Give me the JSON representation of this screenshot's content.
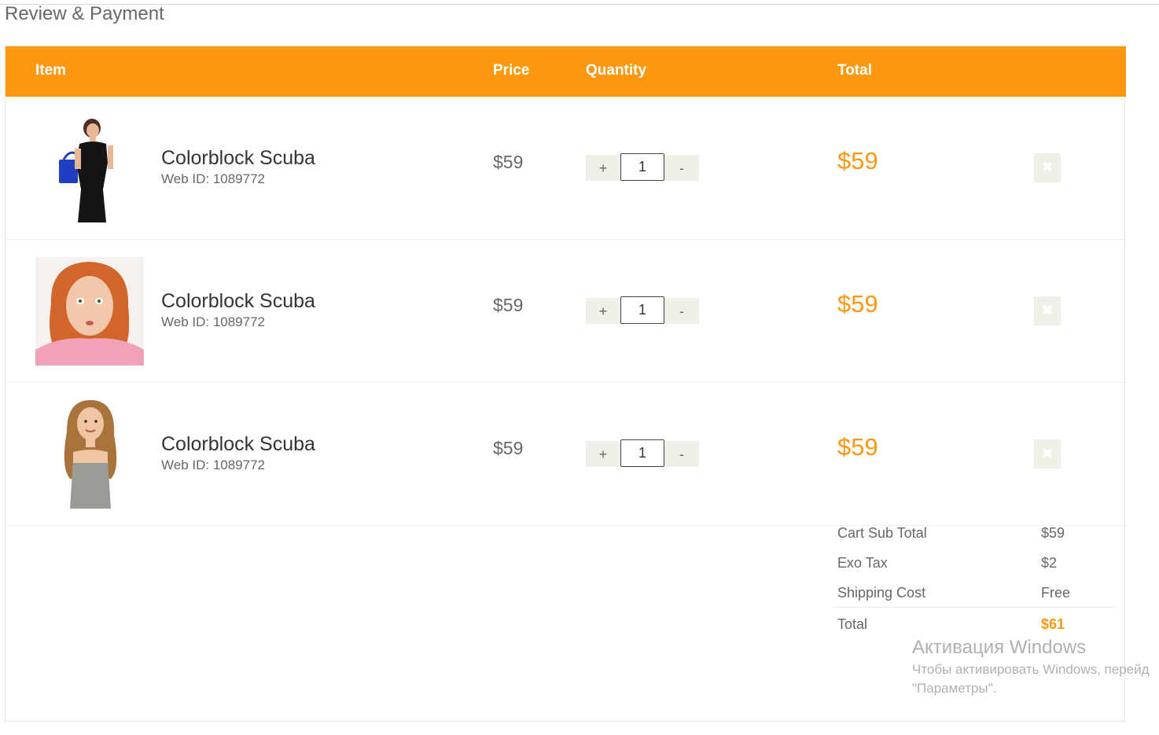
{
  "page": {
    "title": "Review & Payment"
  },
  "cart_header": {
    "item": "Item",
    "price": "Price",
    "quantity": "Quantity",
    "total": "Total"
  },
  "items": [
    {
      "name": "Colorblock Scuba",
      "web_id": "Web ID: 1089772",
      "price": "$59",
      "quantity": "1",
      "total": "$59",
      "plus": "+",
      "minus": "-"
    },
    {
      "name": "Colorblock Scuba",
      "web_id": "Web ID: 1089772",
      "price": "$59",
      "quantity": "1",
      "total": "$59",
      "plus": "+",
      "minus": "-"
    },
    {
      "name": "Colorblock Scuba",
      "web_id": "Web ID: 1089772",
      "price": "$59",
      "quantity": "1",
      "total": "$59",
      "plus": "+",
      "minus": "-"
    }
  ],
  "delete_icon": "✖",
  "summary": {
    "subtotal_label": "Cart Sub Total",
    "subtotal_value": "$59",
    "tax_label": "Exo Tax",
    "tax_value": "$2",
    "shipping_label": "Shipping Cost",
    "shipping_value": "Free",
    "total_label": "Total",
    "total_value": "$61"
  },
  "watermark": {
    "title": "Активация Windows",
    "line1": "Чтобы активировать Windows, перейд",
    "line2": "\"Параметры\"."
  },
  "colors": {
    "accent": "#fe980f",
    "muted_text": "#696763",
    "button_bg": "#f0f0e9"
  },
  "icons": [
    "close-icon",
    "plus-icon",
    "minus-icon"
  ]
}
